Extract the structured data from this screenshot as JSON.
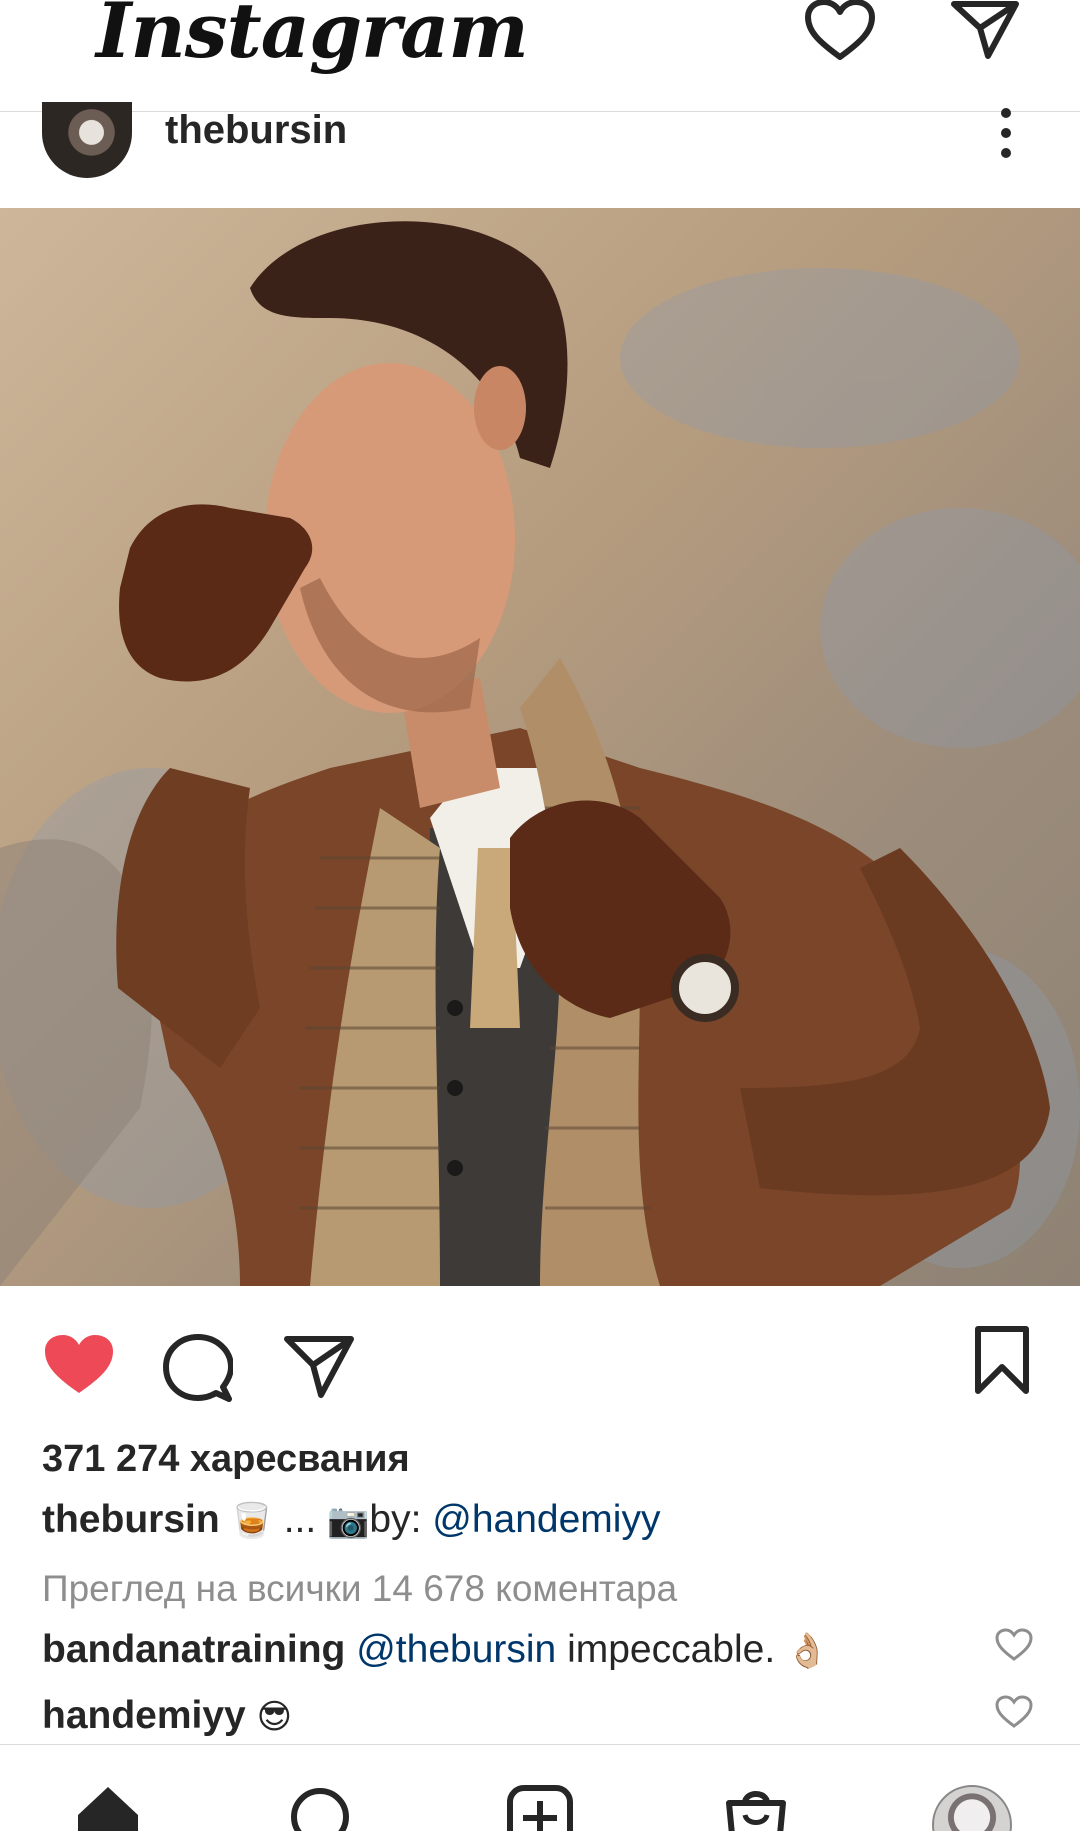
{
  "app": {
    "brand": "Instagram"
  },
  "icons": {
    "top_right": [
      "heart-icon",
      "direct-send-icon"
    ],
    "actions": [
      "like-heart-filled-icon",
      "comment-icon",
      "share-icon",
      "save-bookmark-icon"
    ],
    "bottom_nav": [
      "home-icon",
      "search-icon",
      "new-post-icon",
      "shop-icon",
      "profile-avatar"
    ]
  },
  "colors": {
    "like_red": "#ed4956",
    "mention_blue": "#00376b",
    "muted_gray": "#8e8e8e",
    "text": "#262626"
  },
  "post": {
    "username": "thebursin",
    "likes_text": "371 274 харесвания",
    "caption": {
      "username": "thebursin",
      "emoji_glass": "🥃",
      "ellipsis": " ... ",
      "emoji_camera": "📷",
      "by_text": "by: ",
      "mention": "@handemiyy"
    },
    "view_all_comments": "Преглед на всички 14 678 коментара",
    "comments": [
      {
        "username": "bandanatraining",
        "mention": "@thebursin",
        "text": " impeccable. ",
        "emoji": "👌🏼"
      },
      {
        "username": "handemiyy",
        "emoji": "😎"
      }
    ]
  }
}
